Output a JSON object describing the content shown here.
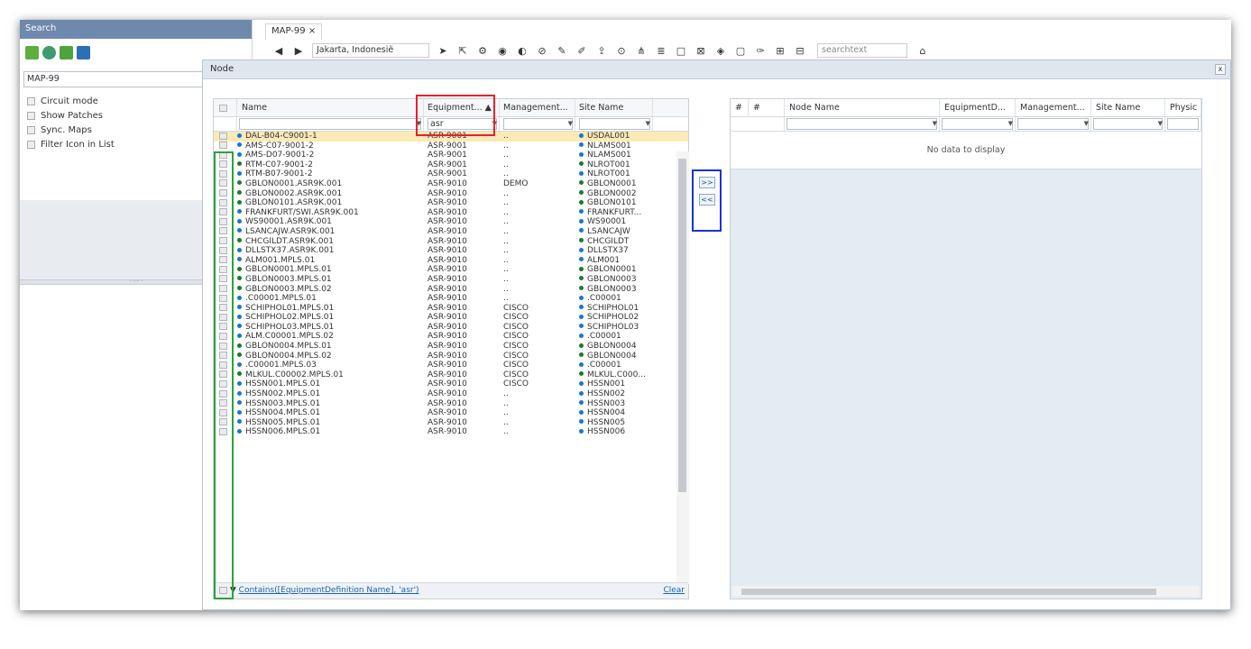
{
  "left_panel": {
    "search_label": "Search",
    "map_value": "MAP-99",
    "options": [
      "Circuit mode",
      "Show Patches",
      "Sync. Maps",
      "Filter Icon in List"
    ],
    "splitter": "· ···· ·"
  },
  "top": {
    "tab_label": "MAP-99",
    "tab_close": "×",
    "location": "Jakarta, Indonesië",
    "search_placeholder": "searchtext"
  },
  "dialog": {
    "title": "Node",
    "close": "x"
  },
  "left_grid": {
    "headers": [
      "Name",
      "Equipment...",
      "Management...",
      "Site Name"
    ],
    "filter_value": "asr",
    "rows": [
      [
        "DAL-B04-C9001-1",
        "ASR-9001",
        "..",
        "USDAL001",
        "#1976d2"
      ],
      [
        "AMS-C07-9001-2",
        "ASR-9001",
        "..",
        "NLAMS001",
        "#1976d2"
      ],
      [
        "AMS-D07-9001-2",
        "ASR-9001",
        "..",
        "NLAMS001",
        "#1976d2"
      ],
      [
        "RTM-C07-9001-2",
        "ASR-9001",
        "..",
        "NLROT001",
        "#1b7a2e"
      ],
      [
        "RTM-B07-9001-2",
        "ASR-9001",
        "..",
        "NLROT001",
        "#1976d2"
      ],
      [
        "GBLON0001.ASR9K.001",
        "ASR-9010",
        "DEMO",
        "GBLON0001",
        "#1b7a2e"
      ],
      [
        "GBLON0002.ASR9K.001",
        "ASR-9010",
        "..",
        "GBLON0002",
        "#1b7a2e"
      ],
      [
        "GBLON0101.ASR9K.001",
        "ASR-9010",
        "..",
        "GBLON0101",
        "#1b7a2e"
      ],
      [
        "FRANKFURT/SWI.ASR9K.001",
        "ASR-9010",
        "..",
        "FRANKFURT...",
        "#1976d2"
      ],
      [
        "WS90001.ASR9K.001",
        "ASR-9010",
        "..",
        "WS90001",
        "#1976d2"
      ],
      [
        "LSANCAJW.ASR9K.001",
        "ASR-9010",
        "..",
        "LSANCAJW",
        "#1976d2"
      ],
      [
        "CHCGILDT.ASR9K.001",
        "ASR-9010",
        "..",
        "CHCGILDT",
        "#1b7a2e"
      ],
      [
        "DLLSTX37.ASR9K.001",
        "ASR-9010",
        "..",
        "DLLSTX37",
        "#1976d2"
      ],
      [
        "ALM001.MPLS.01",
        "ASR-9010",
        "..",
        "ALM001",
        "#1976d2"
      ],
      [
        "GBLON0001.MPLS.01",
        "ASR-9010",
        "..",
        "GBLON0001",
        "#1b7a2e"
      ],
      [
        "GBLON0003.MPLS.01",
        "ASR-9010",
        "..",
        "GBLON0003",
        "#1b7a2e"
      ],
      [
        "GBLON0003.MPLS.02",
        "ASR-9010",
        "..",
        "GBLON0003",
        "#1b7a2e"
      ],
      [
        ".C00001.MPLS.01",
        "ASR-9010",
        "..",
        ".C00001",
        "#1976d2"
      ],
      [
        "SCHIPHOL01.MPLS.01",
        "ASR-9010",
        "CISCO",
        "SCHIPHOL01",
        "#1976d2"
      ],
      [
        "SCHIPHOL02.MPLS.01",
        "ASR-9010",
        "CISCO",
        "SCHIPHOL02",
        "#1976d2"
      ],
      [
        "SCHIPHOL03.MPLS.01",
        "ASR-9010",
        "CISCO",
        "SCHIPHOL03",
        "#1976d2"
      ],
      [
        "ALM.C00001.MPLS.02",
        "ASR-9010",
        "CISCO",
        ".C00001",
        "#1976d2"
      ],
      [
        "GBLON0004.MPLS.01",
        "ASR-9010",
        "CISCO",
        "GBLON0004",
        "#1b7a2e"
      ],
      [
        "GBLON0004.MPLS.02",
        "ASR-9010",
        "CISCO",
        "GBLON0004",
        "#1b7a2e"
      ],
      [
        ".C00001.MPLS.03",
        "ASR-9010",
        "CISCO",
        ".C00001",
        "#1976d2"
      ],
      [
        "MLKUL.C00002.MPLS.01",
        "ASR-9010",
        "CISCO",
        "MLKUL.C000...",
        "#1b7a2e"
      ],
      [
        "HSSN001.MPLS.01",
        "ASR-9010",
        "CISCO",
        "HSSN001",
        "#1976d2"
      ],
      [
        "HSSN002.MPLS.01",
        "ASR-9010",
        "..",
        "HSSN002",
        "#1976d2"
      ],
      [
        "HSSN003.MPLS.01",
        "ASR-9010",
        "..",
        "HSSN003",
        "#1976d2"
      ],
      [
        "HSSN004.MPLS.01",
        "ASR-9010",
        "..",
        "HSSN004",
        "#1976d2"
      ],
      [
        "HSSN005.MPLS.01",
        "ASR-9010",
        "..",
        "HSSN005",
        "#1976d2"
      ],
      [
        "HSSN006.MPLS.01",
        "ASR-9010",
        "..",
        "HSSN006",
        "#1976d2"
      ]
    ],
    "filter_expression": "Contains([EquipmentDefinition Name], 'asr')",
    "clear_label": "Clear"
  },
  "move_buttons": {
    "add_all": ">>",
    "remove_all": "<<"
  },
  "right_grid": {
    "headers": [
      "#",
      "#",
      "Node Name",
      "EquipmentD...",
      "Management...",
      "Site Name",
      "Physic"
    ],
    "empty_text": "No data to display"
  },
  "highlight_colors": {
    "red": "#e8202a",
    "blue": "#1832d8",
    "green": "#2aa33a"
  }
}
